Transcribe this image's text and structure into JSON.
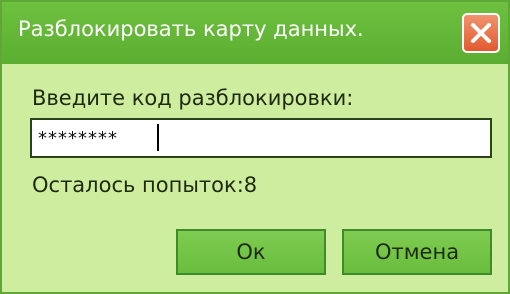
{
  "window": {
    "title": "Разблокировать карту данных.",
    "close_icon": "close-icon"
  },
  "form": {
    "prompt_label": "Введите код разблокировки:",
    "code_value": "********",
    "attempts_text": "Осталось попыток:8"
  },
  "buttons": {
    "ok_label": "Ок",
    "cancel_label": "Отмена"
  },
  "colors": {
    "titlebar": "#62b536",
    "body": "#cfed9f",
    "close_button": "#e5673f",
    "button": "#72c247"
  }
}
